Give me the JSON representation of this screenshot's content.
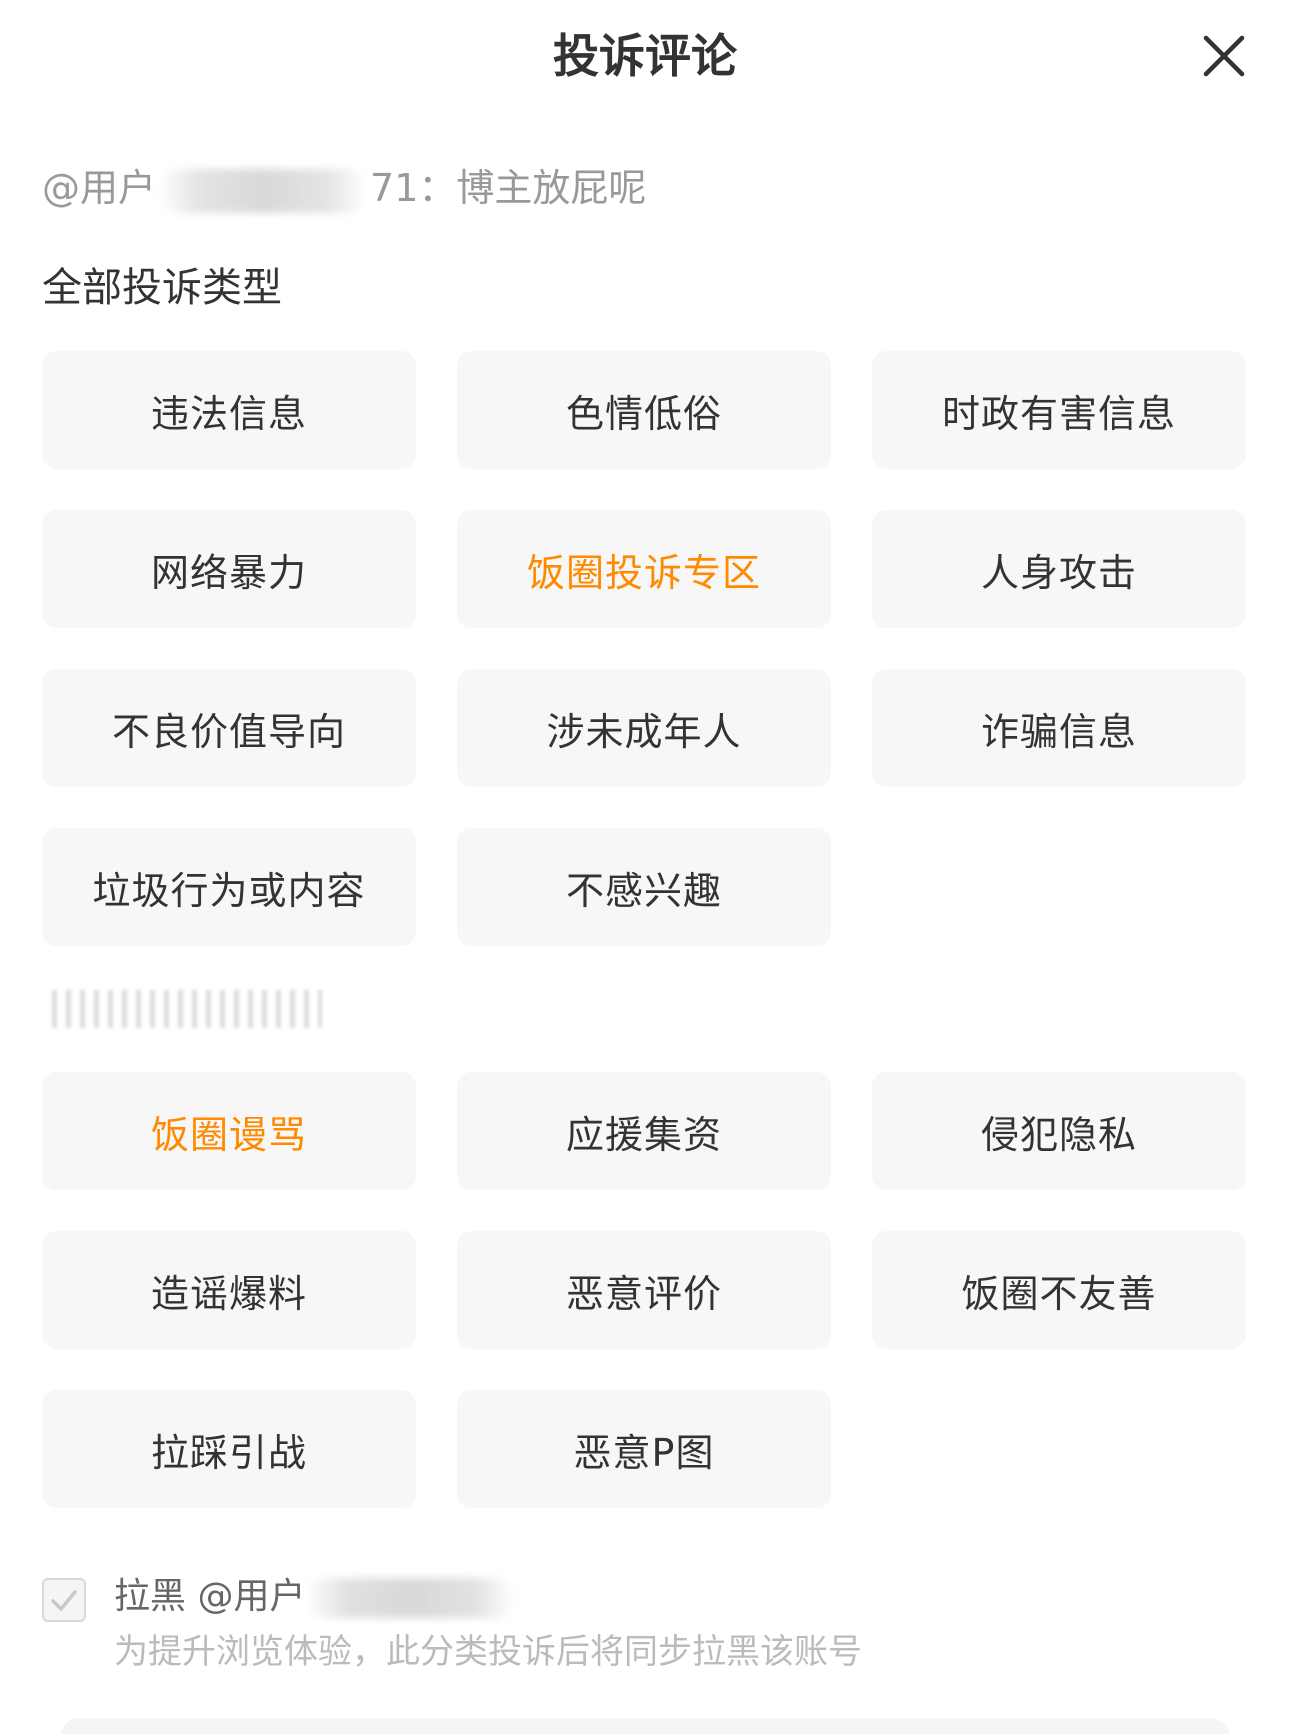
{
  "dialog": {
    "title": "投诉评论",
    "close_icon": "close-icon"
  },
  "quote": {
    "prefix": "@用户",
    "suffix": "71：",
    "comment": "博主放屁呢"
  },
  "section_all": {
    "label": "全部投诉类型"
  },
  "categories_all": [
    {
      "label": "违法信息",
      "highlight": false
    },
    {
      "label": "色情低俗",
      "highlight": false
    },
    {
      "label": "时政有害信息",
      "highlight": false
    },
    {
      "label": "网络暴力",
      "highlight": false
    },
    {
      "label": "饭圈投诉专区",
      "highlight": true
    },
    {
      "label": "人身攻击",
      "highlight": false
    },
    {
      "label": "不良价值导向",
      "highlight": false
    },
    {
      "label": "涉未成年人",
      "highlight": false
    },
    {
      "label": "诈骗信息",
      "highlight": false
    },
    {
      "label": "垃圾行为或内容",
      "highlight": false
    },
    {
      "label": "不感兴趣",
      "highlight": false
    }
  ],
  "categories_fandom": [
    {
      "label": "饭圈谩骂",
      "highlight": true
    },
    {
      "label": "应援集资",
      "highlight": false
    },
    {
      "label": "侵犯隐私",
      "highlight": false
    },
    {
      "label": "造谣爆料",
      "highlight": false
    },
    {
      "label": "恶意评价",
      "highlight": false
    },
    {
      "label": "饭圈不友善",
      "highlight": false
    },
    {
      "label": "拉踩引战",
      "highlight": false
    },
    {
      "label": "恶意P图",
      "highlight": false
    }
  ],
  "block": {
    "checked": true,
    "label_prefix": "拉黑 @用户",
    "hint": "为提升浏览体验，此分类投诉后将同步拉黑该账号"
  },
  "colors": {
    "highlight": "#ff8a00",
    "chip_bg": "#f7f7f7",
    "text": "#333333",
    "muted": "#999999"
  }
}
